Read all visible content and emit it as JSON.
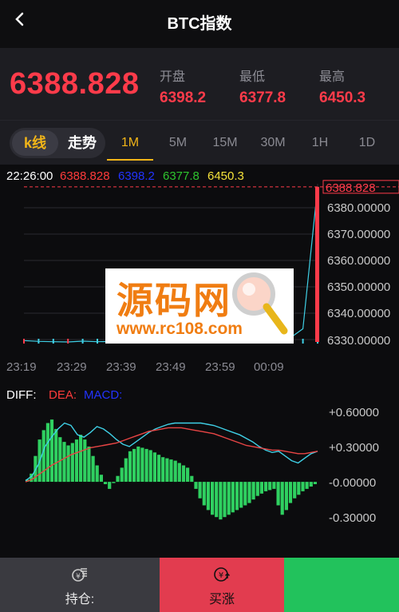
{
  "header": {
    "back_icon": "chevron-left-icon",
    "title": "BTC指数"
  },
  "quote": {
    "last_price": "6388.828",
    "stats": [
      {
        "label": "开盘",
        "value": "6398.2"
      },
      {
        "label": "最低",
        "value": "6377.8"
      },
      {
        "label": "最高",
        "value": "6450.3"
      }
    ]
  },
  "tabs": {
    "mode_kline": "k线",
    "mode_trend": "走势",
    "timeframes": [
      "1M",
      "5M",
      "15M",
      "30M",
      "1H",
      "1D"
    ],
    "active_timeframe": "1M"
  },
  "info_bar": {
    "time": "22:26:00",
    "values": [
      {
        "text": "6388.828",
        "color": "#ff3b3b"
      },
      {
        "text": "6398.2",
        "color": "#2233ff"
      },
      {
        "text": "6377.8",
        "color": "#2ec42e"
      },
      {
        "text": "6450.3",
        "color": "#f5e23a"
      }
    ]
  },
  "colors": {
    "up": "#ff3b4a",
    "accent": "#f2b518",
    "macd_up": "#2fd060",
    "diff_line": "#3fd0e6",
    "dea_line": "#e84545",
    "buy_bg": "#e23c4f",
    "sell_bg": "#22c25c",
    "hold_bg": "#3a3a40"
  },
  "chart_data": [
    {
      "type": "line",
      "title": "",
      "x": [
        "23:19",
        "23:29",
        "23:39",
        "23:49",
        "23:59",
        "00:09"
      ],
      "yticks": [
        "6388.828",
        "6380.00000",
        "6370.00000",
        "6360.00000",
        "6350.00000",
        "6340.00000",
        "6330.00000"
      ],
      "ylim": [
        6330,
        6390
      ],
      "last_price_line": 6388.828,
      "series": [
        {
          "values": [
            6330.5,
            6330.2,
            6330.1,
            6330.0,
            6330.3,
            6330.1,
            6330.2,
            6330.4,
            6330.1,
            6330.0,
            6330.2,
            6330.1,
            6330.3,
            6330.2,
            6330.1,
            6330.0,
            6330.2,
            6330.4,
            6331.0,
            6335.0,
            6388.8
          ]
        }
      ],
      "grid": true
    },
    {
      "type": "bar",
      "title": "",
      "legend": [
        "DIFF:",
        "DEA:",
        "MACD:"
      ],
      "legend_colors": [
        "#ffffff",
        "#ff3b3b",
        "#2233ff"
      ],
      "yticks": [
        "+0.60000",
        "+0.30000",
        "-0.00000",
        "-0.30000"
      ],
      "ylim": [
        -0.36,
        0.66
      ],
      "macd_values": [
        0.02,
        0.07,
        0.22,
        0.36,
        0.44,
        0.5,
        0.53,
        0.45,
        0.38,
        0.34,
        0.31,
        0.33,
        0.36,
        0.4,
        0.36,
        0.3,
        0.22,
        0.14,
        0.06,
        -0.02,
        -0.06,
        -0.01,
        0.05,
        0.12,
        0.2,
        0.26,
        0.28,
        0.3,
        0.29,
        0.28,
        0.27,
        0.25,
        0.23,
        0.21,
        0.2,
        0.19,
        0.18,
        0.16,
        0.14,
        0.12,
        0.05,
        -0.06,
        -0.14,
        -0.2,
        -0.24,
        -0.28,
        -0.3,
        -0.32,
        -0.3,
        -0.28,
        -0.26,
        -0.24,
        -0.22,
        -0.2,
        -0.18,
        -0.15,
        -0.12,
        -0.1,
        -0.08,
        -0.07,
        -0.06,
        -0.2,
        -0.28,
        -0.24,
        -0.18,
        -0.14,
        -0.11,
        -0.08,
        -0.06,
        -0.04,
        -0.02
      ],
      "diff_values": [
        0.01,
        0.05,
        0.15,
        0.3,
        0.38,
        0.45,
        0.5,
        0.48,
        0.4,
        0.38,
        0.42,
        0.47,
        0.45,
        0.41,
        0.36,
        0.32,
        0.3,
        0.34,
        0.38,
        0.42,
        0.45,
        0.47,
        0.49,
        0.5,
        0.5,
        0.5,
        0.5,
        0.5,
        0.49,
        0.48,
        0.46,
        0.44,
        0.42,
        0.4,
        0.37,
        0.34,
        0.3,
        0.27,
        0.25,
        0.26,
        0.22,
        0.18,
        0.16,
        0.2,
        0.24,
        0.26
      ],
      "dea_values": [
        0.0,
        0.02,
        0.06,
        0.1,
        0.14,
        0.17,
        0.2,
        0.23,
        0.25,
        0.27,
        0.29,
        0.3,
        0.31,
        0.32,
        0.33,
        0.35,
        0.37,
        0.39,
        0.41,
        0.43,
        0.44,
        0.45,
        0.46,
        0.46,
        0.46,
        0.45,
        0.44,
        0.43,
        0.42,
        0.41,
        0.39,
        0.37,
        0.35,
        0.33,
        0.31,
        0.3,
        0.29,
        0.28,
        0.27,
        0.27,
        0.26,
        0.25,
        0.24,
        0.24,
        0.25,
        0.26
      ],
      "grid": false
    }
  ],
  "footer": {
    "hold": {
      "label": "持仓:",
      "icon": "coin-stack-icon"
    },
    "buy_up": {
      "label": "买涨",
      "icon": "yen-up-icon"
    },
    "buy_down": {
      "label": "",
      "icon": ""
    }
  },
  "watermark": {
    "text": "源码网",
    "url": "www.rc108.com",
    "icon": "magnifier-icon"
  }
}
